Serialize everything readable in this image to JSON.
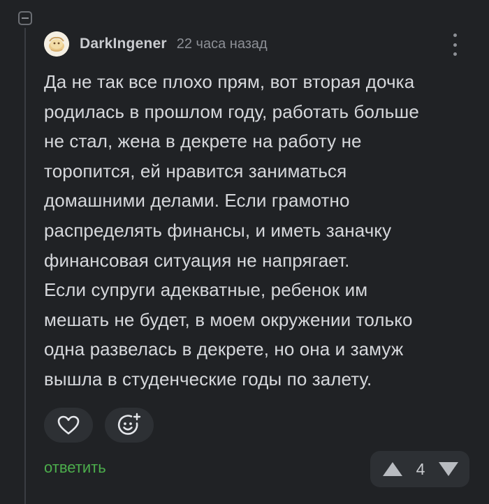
{
  "comment": {
    "author": "DarkIngener",
    "time": "22 часа назад",
    "paragraphs": [
      "Да не так все плохо прям, вот вторая дочка\nродилась в прошлом году, работать больше\nне стал, жена в декрете на работу не\nторопится, ей нравится заниматься\nдомашними делами. Если грамотно\nраспределять финансы, и иметь заначку\nфинансовая ситуация не напрягает.",
      "Если супруги адекватные, ребенок им\nмешать не будет, в моем окружении только\nодна развелась в декрете, но она и замуж\nвышла в студенческие годы по залету."
    ],
    "reply_label": "ответить",
    "rating": "4"
  },
  "icons": {
    "collapse": "minus-square-icon",
    "more": "vertical-dots-icon",
    "like": "heart-icon",
    "react": "smiley-plus-icon",
    "upvote": "triangle-up-icon",
    "downvote": "triangle-down-icon"
  },
  "colors": {
    "background": "#202225",
    "text": "#d6d8dc",
    "muted": "#8d9096",
    "accent_green": "#4cae4c",
    "button_bg": "#2d3034"
  }
}
